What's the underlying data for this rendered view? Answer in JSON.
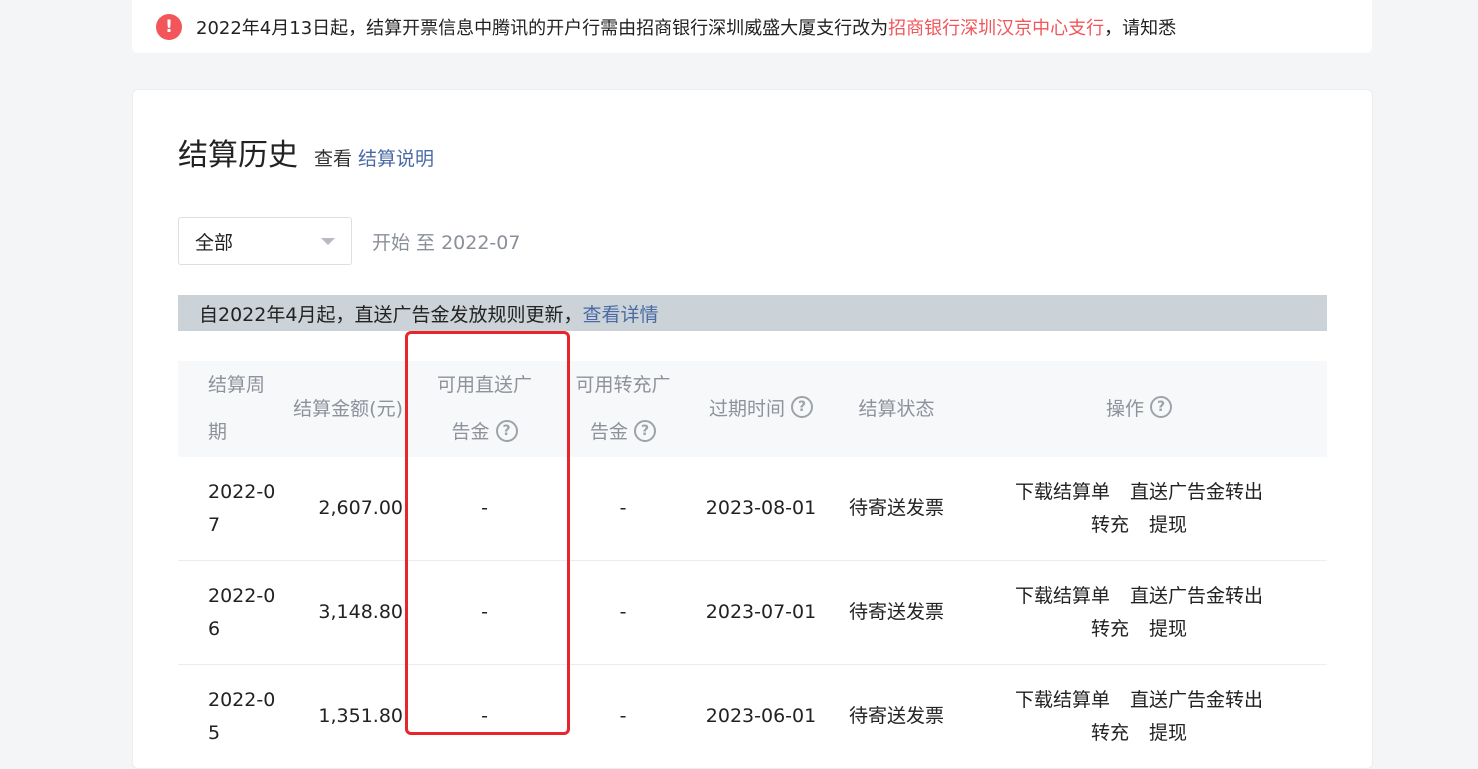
{
  "notice": {
    "before": "2022年4月13日起，结算开票信息中腾讯的开户行需由招商银行深圳威盛大厦支行改为",
    "highlight": "招商银行深圳汉京中心支行",
    "after": "，请知悉"
  },
  "header": {
    "title": "结算历史",
    "sub": "查看",
    "link": "结算说明"
  },
  "filter": {
    "selected": "全部",
    "range": "开始 至 2022-07"
  },
  "banner": {
    "text": "自2022年4月起，直送广告金发放规则更新，",
    "link": "查看详情"
  },
  "table": {
    "headers": {
      "period_a": "结算周",
      "period_b": "期",
      "amount": "结算金额(元)",
      "direct_a": "可用直送广",
      "direct_b": "告金",
      "transfer_a": "可用转充广",
      "transfer_b": "告金",
      "expire": "过期时间",
      "status": "结算状态",
      "ops": "操作"
    },
    "rows": [
      {
        "period_a": "2022-0",
        "period_b": "7",
        "amount": "2,607.00",
        "direct": "-",
        "transfer": "-",
        "expire": "2023-08-01",
        "status": "待寄送发票",
        "op1": "下载结算单",
        "op2": "直送广告金转出",
        "op3": "转充",
        "op4": "提现"
      },
      {
        "period_a": "2022-0",
        "period_b": "6",
        "amount": "3,148.80",
        "direct": "-",
        "transfer": "-",
        "expire": "2023-07-01",
        "status": "待寄送发票",
        "op1": "下载结算单",
        "op2": "直送广告金转出",
        "op3": "转充",
        "op4": "提现"
      },
      {
        "period_a": "2022-0",
        "period_b": "5",
        "amount": "1,351.80",
        "direct": "-",
        "transfer": "-",
        "expire": "2023-06-01",
        "status": "待寄送发票",
        "op1": "下载结算单",
        "op2": "直送广告金转出",
        "op3": "转充",
        "op4": "提现"
      }
    ]
  },
  "icons": {
    "alert": "!",
    "help": "?"
  },
  "colors": {
    "accent_red": "#f2555a",
    "link_blue": "#4a6aa5",
    "annotation_red": "#e8252a"
  }
}
